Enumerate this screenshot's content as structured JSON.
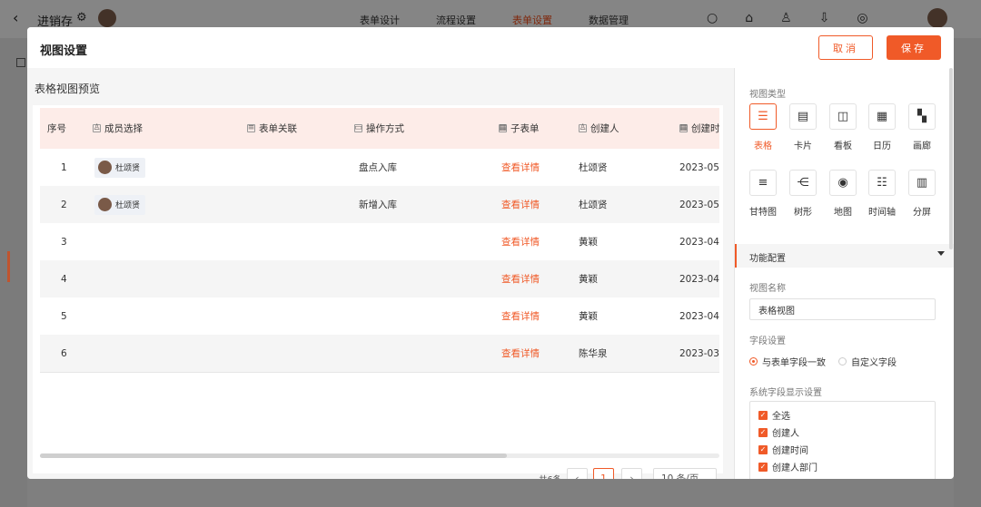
{
  "topbar": {
    "app_name": "进销存",
    "tabs": [
      "表单设计",
      "流程设置",
      "表单设置",
      "数据管理"
    ],
    "active_tab": "表单设置"
  },
  "modal": {
    "title": "视图设置",
    "cancel_label": "取消",
    "save_label": "保存"
  },
  "preview": {
    "title": "表格视图预览",
    "columns": [
      {
        "label": "序号",
        "icon": "none"
      },
      {
        "label": "成员选择",
        "icon": "member-icon"
      },
      {
        "label": "表单关联",
        "icon": "link-form-icon"
      },
      {
        "label": "操作方式",
        "icon": "operate-icon"
      },
      {
        "label": "子表单",
        "icon": "subform-icon"
      },
      {
        "label": "创建人",
        "icon": "creator-icon"
      },
      {
        "label": "创建时",
        "icon": "calendar-icon"
      }
    ],
    "rows": [
      {
        "no": "1",
        "member": "杜颂贤",
        "operate": "盘点入库",
        "subform": "查看详情",
        "creator": "杜颂贤",
        "created": "2023-05-"
      },
      {
        "no": "2",
        "member": "杜颂贤",
        "operate": "新增入库",
        "subform": "查看详情",
        "creator": "杜颂贤",
        "created": "2023-05-"
      },
      {
        "no": "3",
        "member": "",
        "operate": "",
        "subform": "查看详情",
        "creator": "黄颖",
        "created": "2023-04-"
      },
      {
        "no": "4",
        "member": "",
        "operate": "",
        "subform": "查看详情",
        "creator": "黄颖",
        "created": "2023-04-"
      },
      {
        "no": "5",
        "member": "",
        "operate": "",
        "subform": "查看详情",
        "creator": "黄颖",
        "created": "2023-04-"
      },
      {
        "no": "6",
        "member": "",
        "operate": "",
        "subform": "查看详情",
        "creator": "陈华泉",
        "created": "2023-03-"
      }
    ],
    "pagination": {
      "total": "共6条",
      "current": "1",
      "page_size": "10 条/页"
    }
  },
  "settings": {
    "view_type_label": "视图类型",
    "view_types": [
      {
        "label": "表格",
        "icon": "table-icon",
        "selected": true
      },
      {
        "label": "卡片",
        "icon": "card-icon",
        "selected": false
      },
      {
        "label": "看板",
        "icon": "kanban-icon",
        "selected": false
      },
      {
        "label": "日历",
        "icon": "calendar-icon",
        "selected": false
      },
      {
        "label": "画廊",
        "icon": "gallery-icon",
        "selected": false
      },
      {
        "label": "甘特图",
        "icon": "gantt-icon",
        "selected": false
      },
      {
        "label": "树形",
        "icon": "tree-icon",
        "selected": false
      },
      {
        "label": "地图",
        "icon": "map-icon",
        "selected": false
      },
      {
        "label": "时间轴",
        "icon": "timeline-icon",
        "selected": false
      },
      {
        "label": "分屏",
        "icon": "split-icon",
        "selected": false
      }
    ],
    "section_title": "功能配置",
    "view_name_label": "视图名称",
    "view_name_value": "表格视图",
    "field_setting_label": "字段设置",
    "field_options": [
      {
        "label": "与表单字段一致",
        "checked": true
      },
      {
        "label": "自定义字段",
        "checked": false
      }
    ],
    "system_fields_label": "系统字段显示设置",
    "system_fields": [
      "全选",
      "创建人",
      "创建时间",
      "创建人部门"
    ]
  },
  "colors": {
    "accent": "#f05a28",
    "header_bg": "#fdece8"
  }
}
